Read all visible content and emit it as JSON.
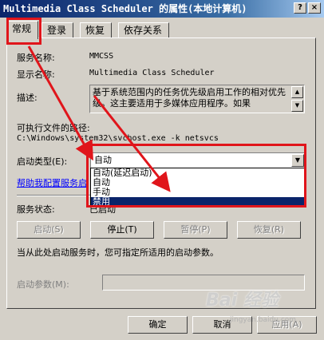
{
  "window": {
    "title": "Multimedia Class Scheduler 的属性(本地计算机)",
    "help_btn": "?",
    "close_btn": "×"
  },
  "tabs": [
    {
      "label": "常规",
      "active": true
    },
    {
      "label": "登录"
    },
    {
      "label": "恢复"
    },
    {
      "label": "依存关系"
    }
  ],
  "general": {
    "service_name_label": "服务名称:",
    "service_name": "MMCSS",
    "display_name_label": "显示名称:",
    "display_name": "Multimedia Class Scheduler",
    "description_label": "描述:",
    "description": "基于系统范围内的任务优先级启用工作的相对优先级。这主要适用于多媒体应用程序。如果",
    "exe_path_label": "可执行文件的路径:",
    "exe_path": "C:\\Windows\\system32\\svchost.exe -k netsvcs",
    "startup_type_label": "启动类型(E):",
    "startup_type_value": "自动",
    "startup_options": [
      "自动(延迟启动)",
      "自动",
      "手动",
      "禁用"
    ],
    "selected_option": "禁用",
    "help_link": "帮助我配置服务启",
    "status_label": "服务状态:",
    "status_value": "已启动",
    "buttons": {
      "start": "启动(S)",
      "stop": "停止(T)",
      "pause": "暂停(P)",
      "resume": "恢复(R)"
    },
    "hint": "当从此处启动服务时，您可指定所适用的启动参数。",
    "params_label": "启动参数(M):"
  },
  "footer": {
    "ok": "确定",
    "cancel": "取消",
    "apply": "应用(A)"
  },
  "annotation_color": "#e0151b",
  "watermark": {
    "logo": "Bai 经验",
    "sub": "jingyan.baidu.com"
  }
}
